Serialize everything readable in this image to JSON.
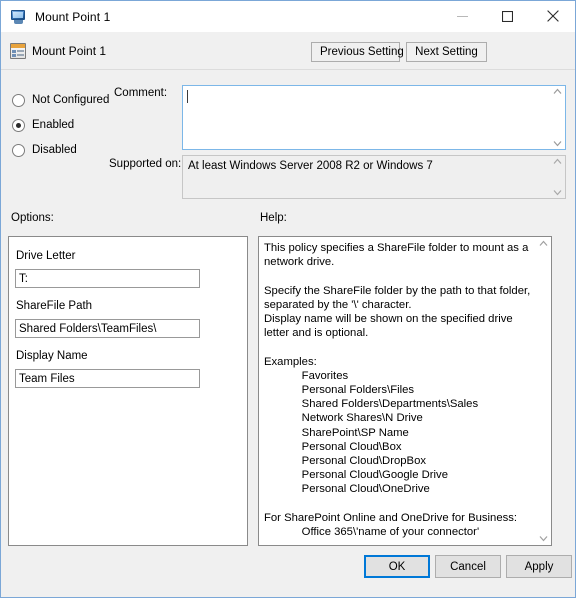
{
  "window": {
    "title": "Mount Point 1",
    "title_icon": "computer-monitor-icon",
    "minimize_label": "—",
    "maximize_label": "□",
    "close_label": "×"
  },
  "header": {
    "policy_name": "Mount Point 1",
    "policy_icon": "policy-setting-icon",
    "previous_setting": "Previous Setting",
    "next_setting": "Next Setting"
  },
  "state": {
    "options": [
      {
        "label": "Not Configured",
        "selected": false
      },
      {
        "label": "Enabled",
        "selected": true
      },
      {
        "label": "Disabled",
        "selected": false
      }
    ],
    "comment_label": "Comment:",
    "comment_value": "",
    "supported_label": "Supported on:",
    "supported_value": "At least Windows Server 2008 R2 or Windows 7"
  },
  "panels": {
    "options_label": "Options:",
    "help_label": "Help:"
  },
  "options": {
    "fields": [
      {
        "label": "Drive Letter",
        "value": "T:"
      },
      {
        "label": "ShareFile Path",
        "value": "Shared Folders\\TeamFiles\\"
      },
      {
        "label": "Display Name",
        "value": "Team Files"
      }
    ]
  },
  "help": {
    "text": "This policy specifies a ShareFile folder to mount as a network drive.\n\nSpecify the ShareFile folder by the path to that folder, separated by the '\\' character.\nDisplay name will be shown on the specified drive letter and is optional.\n\nExamples:\n            Favorites\n            Personal Folders\\Files\n            Shared Folders\\Departments\\Sales\n            Network Shares\\N Drive\n            SharePoint\\SP Name\n            Personal Cloud\\Box\n            Personal Cloud\\DropBox\n            Personal Cloud\\Google Drive\n            Personal Cloud\\OneDrive\n\nFor SharePoint Online and OneDrive for Business:\n            Office 365\\'name of your connector'"
  },
  "footer": {
    "ok": "OK",
    "cancel": "Cancel",
    "apply": "Apply"
  },
  "colors": {
    "window_border": "#7ba7d7",
    "focus_blue": "#0078d7",
    "comment_focus_border": "#7cb7e8",
    "dialog_bg": "#f0f0f0"
  }
}
